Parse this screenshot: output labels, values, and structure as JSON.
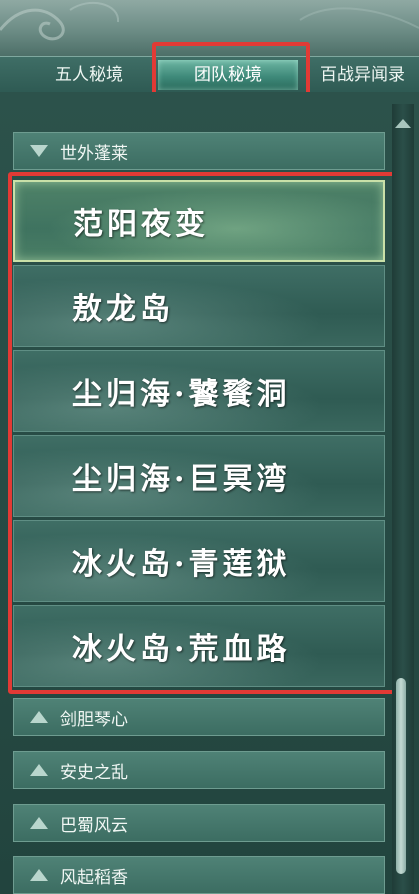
{
  "tabs": [
    {
      "label": "五人秘境",
      "active": false
    },
    {
      "label": "团队秘境",
      "active": true
    },
    {
      "label": "百战异闻录",
      "active": false
    }
  ],
  "group_expanded": {
    "label": "世外蓬莱"
  },
  "entries": [
    {
      "label": "范阳夜变",
      "selected": true
    },
    {
      "label": "敖龙岛",
      "selected": false
    },
    {
      "label": "尘归海·饕餮洞",
      "selected": false
    },
    {
      "label": "尘归海·巨冥湾",
      "selected": false
    },
    {
      "label": "冰火岛·青莲狱",
      "selected": false
    },
    {
      "label": "冰火岛·荒血路",
      "selected": false
    }
  ],
  "groups_collapsed": [
    {
      "label": "剑胆琴心"
    },
    {
      "label": "安史之乱"
    },
    {
      "label": "巴蜀风云"
    },
    {
      "label": "风起稻香"
    }
  ],
  "colors": {
    "highlight_box": "#e23a35",
    "active_tab": "#3f8a7a"
  },
  "icons": {
    "expanded": "triangle-down-icon",
    "collapsed": "triangle-up-icon"
  }
}
